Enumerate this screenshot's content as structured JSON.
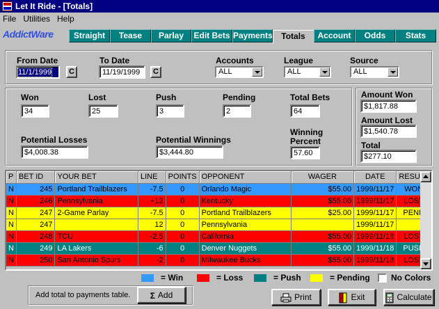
{
  "window": {
    "title": "Let It Ride - [Totals]"
  },
  "menu": [
    "File",
    "Utilities",
    "Help"
  ],
  "brand": "AddictWare",
  "tabs": [
    "Straight",
    "Tease",
    "Parlay",
    "Edit Bets",
    "Payments",
    "Totals",
    "Account",
    "Odds",
    "Stats"
  ],
  "active_tab": "Totals",
  "filters": {
    "from_date_label": "From Date",
    "from_date": "11/1/1999",
    "to_date_label": "To Date",
    "to_date": "11/19/1999",
    "calendar_btn": "C",
    "accounts_label": "Accounts",
    "accounts": "ALL",
    "league_label": "League",
    "league": "ALL",
    "source_label": "Source",
    "source": "ALL"
  },
  "totals": {
    "won_label": "Won",
    "won": "34",
    "lost_label": "Lost",
    "lost": "25",
    "push_label": "Push",
    "push": "3",
    "pending_label": "Pending",
    "pending": "2",
    "total_bets_label": "Total Bets",
    "total_bets": "64",
    "potential_losses_label": "Potential Losses",
    "potential_losses": "$4,008.38",
    "potential_winnings_label": "Potential Winnings",
    "potential_winnings": "$3,444.80",
    "winning_percent_label_1": "Winning",
    "winning_percent_label_2": "Percent",
    "winning_percent": "57.60"
  },
  "amounts": {
    "won_label": "Amount Won",
    "won": "$1,817.88",
    "lost_label": "Amount Lost",
    "lost": "$1,540.78",
    "total_label": "Total",
    "total": "$277.10"
  },
  "table": {
    "columns": [
      "P",
      "BET ID",
      "YOUR BET",
      "LINE",
      "POINTS",
      "OPPONENT",
      "WAGER",
      "DATE",
      "RESULT"
    ],
    "rows": [
      {
        "status": "win",
        "p": "N",
        "id": "245",
        "bet": "Portland Trailblazers",
        "line": "-7.5",
        "points": "0",
        "opponent": "Orlando Magic",
        "wager": "$55.00",
        "date": "1999/11/17",
        "result": "WON"
      },
      {
        "status": "loss",
        "p": "N",
        "id": "246",
        "bet": "Pennsylvania",
        "line": "+12",
        "points": "0",
        "opponent": "Kentucky",
        "wager": "$55.00",
        "date": "1999/11/17",
        "result": "LOST"
      },
      {
        "status": "pend",
        "p": "N",
        "id": "247",
        "bet": "2-Game Parlay",
        "line": "-7.5",
        "points": "0",
        "opponent": "Portland Trailblazers",
        "wager": "$25.00",
        "date": "1999/11/17",
        "result": "PEND"
      },
      {
        "status": "pend",
        "p": "N",
        "id": "247",
        "bet": "",
        "line": "12",
        "points": "0",
        "opponent": "Pennsylvania",
        "wager": "",
        "date": "1999/11/17",
        "result": ""
      },
      {
        "status": "loss",
        "p": "N",
        "id": "248",
        "bet": "TCU",
        "line": "-2.5",
        "points": "0",
        "opponent": "California",
        "wager": "$55.00",
        "date": "1999/11/18",
        "result": "LOST"
      },
      {
        "status": "push",
        "p": "N",
        "id": "249",
        "bet": "LA Lakers",
        "line": "-6",
        "points": "0",
        "opponent": "Denver Nuggets",
        "wager": "$55.00",
        "date": "1999/11/18",
        "result": "PUSH"
      },
      {
        "status": "loss",
        "p": "N",
        "id": "250",
        "bet": "San Antonio Spurs",
        "line": "-2",
        "points": "0",
        "opponent": "Milwaukee Bucks",
        "wager": "$55.00",
        "date": "1999/11/18",
        "result": "LOST"
      }
    ]
  },
  "legend": {
    "win": "= Win",
    "loss": "= Loss",
    "push": "= Push",
    "pending": "= Pending",
    "no_colors": "No Colors",
    "colors": {
      "win": "#3399ff",
      "loss": "#ff0000",
      "push": "#008080",
      "pending": "#ffff00"
    }
  },
  "footer": {
    "add_hint": "Add total to payments table.",
    "add": "Add",
    "print": "Print",
    "exit": "Exit",
    "calculate": "Calculate"
  }
}
